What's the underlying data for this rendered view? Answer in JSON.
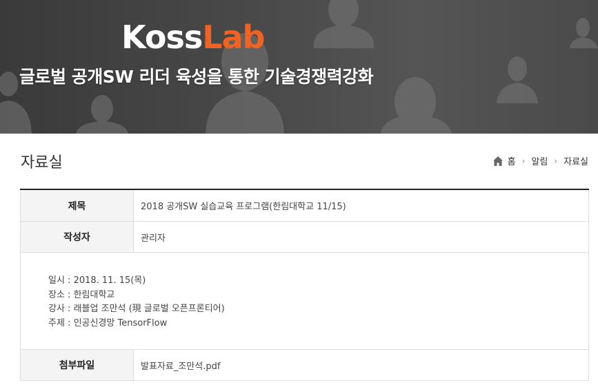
{
  "banner": {
    "logo_part1": "Koss",
    "logo_part2": "Lab",
    "slogan": "글로벌 공개SW 리더 육성을 통한 기술경쟁력강화"
  },
  "page": {
    "title": "자료실"
  },
  "breadcrumb": {
    "home": "홈",
    "level1": "알림",
    "level2": "자료실"
  },
  "post": {
    "title_label": "제목",
    "title_value": "2018 공개SW 실습교육 프로그램(한림대학교 11/15)",
    "author_label": "작성자",
    "author_value": "관리자",
    "content_lines": [
      "일시 : 2018. 11. 15(목)",
      "장소 : 한림대학교",
      "강사 : 래블업 조만석 (現 글로벌 오픈프론티어)",
      "주제 : 인공신경망 TensorFlow"
    ],
    "attachment_label": "첨부파일",
    "attachment_file": "발표자료_조만석.pdf"
  },
  "colors": {
    "accent_orange": "#f26322",
    "header_bar": "#222222"
  }
}
